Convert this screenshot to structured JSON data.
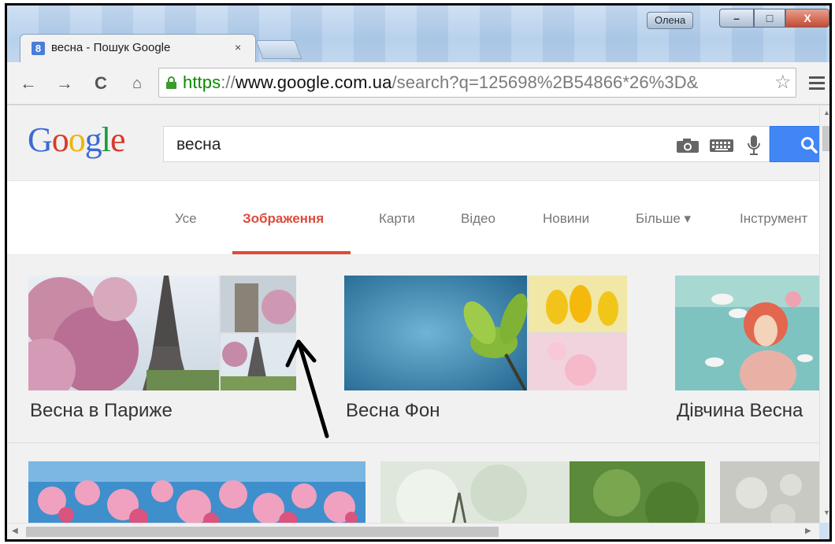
{
  "window": {
    "user_badge": "Олена",
    "minimize_glyph": "–",
    "maximize_glyph": "□",
    "close_glyph": "X"
  },
  "tab": {
    "favicon_letter": "8",
    "title": "весна - Пошук Google",
    "close_glyph": "×"
  },
  "toolbar": {
    "back_glyph": "←",
    "forward_glyph": "→",
    "reload_glyph": "C",
    "home_glyph": "⌂",
    "url_scheme": "https",
    "url_sep": "://",
    "url_host": "www.google.com.ua",
    "url_path": "/search?q=125698%2B54866*26%3D&",
    "star_glyph": "☆"
  },
  "google": {
    "logo_letters": [
      "G",
      "o",
      "o",
      "g",
      "l",
      "e"
    ],
    "query": "весна",
    "tabs": [
      {
        "label": "Усе",
        "active": false
      },
      {
        "label": "Зображення",
        "active": true
      },
      {
        "label": "Карти",
        "active": false
      },
      {
        "label": "Відео",
        "active": false
      },
      {
        "label": "Новини",
        "active": false
      },
      {
        "label": "Більше ▾",
        "active": false
      },
      {
        "label": "Інструмент",
        "active": false
      }
    ]
  },
  "results": {
    "collages": [
      {
        "label": "Весна в Париже"
      },
      {
        "label": "Весна Фон"
      },
      {
        "label": "Дівчина Весна"
      }
    ]
  },
  "scroll": {
    "up_glyph": "▲",
    "down_glyph": "▼",
    "left_glyph": "◀",
    "right_glyph": "▶"
  },
  "colors": {
    "accent_red": "#dd4b39",
    "search_blue": "#4285f4",
    "https_green": "#0b8a00"
  }
}
